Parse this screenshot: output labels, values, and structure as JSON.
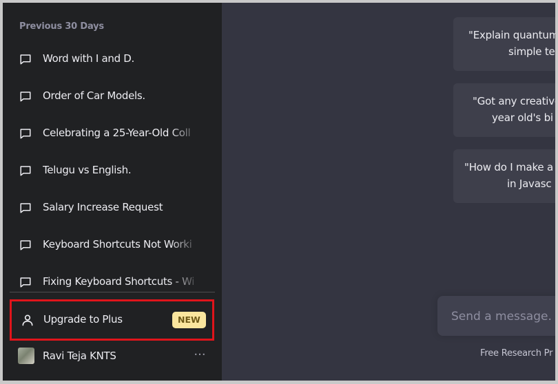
{
  "sidebar": {
    "section_label": "Previous 30 Days",
    "conversations": [
      {
        "label": "Word with I and D."
      },
      {
        "label": "Order of Car Models."
      },
      {
        "label": "Celebrating a 25-Year-Old Coll"
      },
      {
        "label": "Telugu vs English."
      },
      {
        "label": "Salary Increase Request"
      },
      {
        "label": "Keyboard Shortcuts Not Worki"
      },
      {
        "label": "Fixing Keyboard Shortcuts - Wi"
      }
    ],
    "upgrade": {
      "label": "Upgrade to Plus",
      "badge": "NEW"
    },
    "account": {
      "name": "Ravi Teja KNTS",
      "more": "···"
    }
  },
  "main": {
    "examples": [
      {
        "line1": "\"Explain quantum",
        "line2": "simple te"
      },
      {
        "line1": "\"Got any creative",
        "line2": "year old's bi"
      },
      {
        "line1": "\"How do I make a",
        "line2": "in Javasc"
      }
    ],
    "composer": {
      "placeholder": "Send a message."
    },
    "footer_note": "Free Research Pr"
  },
  "colors": {
    "sidebar_bg": "#202123",
    "main_bg": "#343541",
    "highlight_border": "#e0141b",
    "badge_bg": "#fae69e"
  }
}
